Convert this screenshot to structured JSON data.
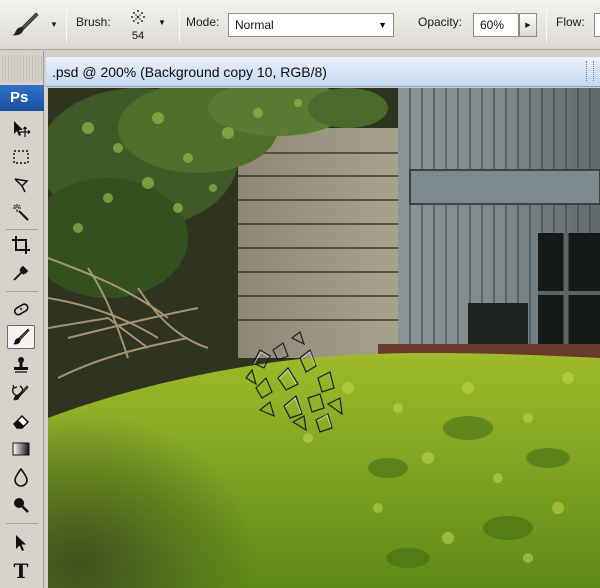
{
  "options_bar": {
    "brush_label": "Brush:",
    "brush_size": "54",
    "mode_label": "Mode:",
    "mode_value": "Normal",
    "opacity_label": "Opacity:",
    "opacity_value": "60%",
    "flow_label": "Flow:"
  },
  "tools": {
    "logo": "Ps",
    "text_tool_glyph": "T"
  },
  "document": {
    "title": ".psd @ 200% (Background copy 10, RGB/8)"
  },
  "colors": {
    "title_bar": "#c5d8f1",
    "ps_logo": "#1a4f9f",
    "panel": "#d6d3cb"
  }
}
